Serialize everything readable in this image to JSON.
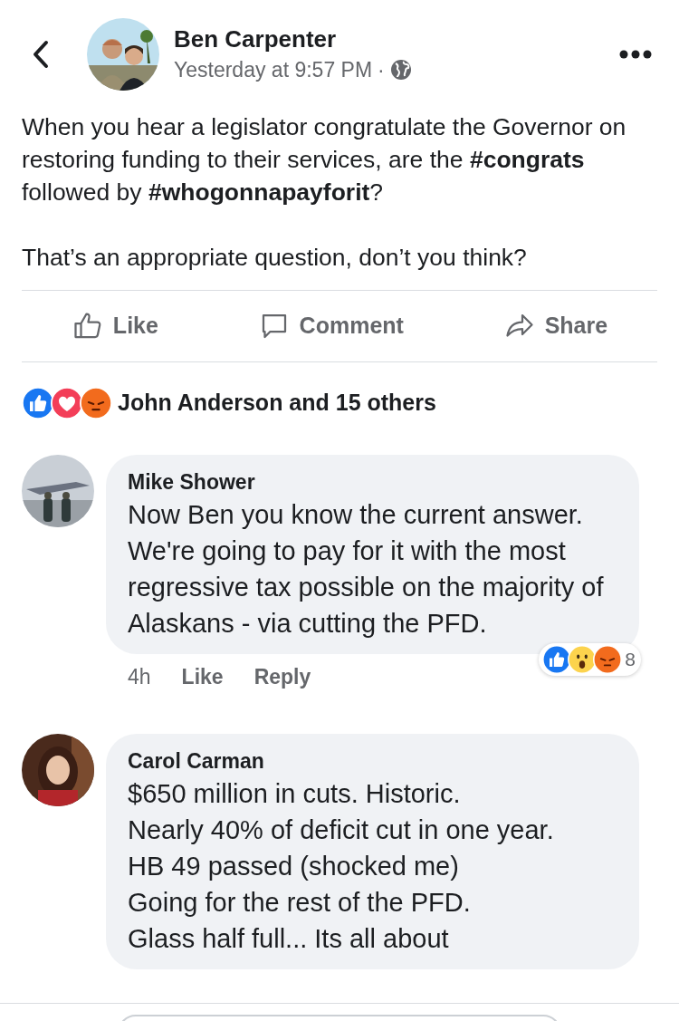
{
  "post": {
    "author": "Ben Carpenter",
    "time": "Yesterday at 9:57 PM",
    "separator": "·",
    "paragraphs": [
      "When you hear a legislator congratulate the Governor on restoring funding to their services, are the **#congrats** followed by **#whogonnapayforit**?",
      "That’s an appropriate question, don’t you think?"
    ]
  },
  "actions": [
    {
      "kind": "like",
      "label": "Like"
    },
    {
      "kind": "comment",
      "label": "Comment"
    },
    {
      "kind": "share",
      "label": "Share"
    }
  ],
  "reactions": {
    "kinds": [
      {
        "kind": "like"
      },
      {
        "kind": "love"
      },
      {
        "kind": "angry"
      }
    ],
    "summary": "John Anderson and 15 others"
  },
  "comments": [
    {
      "name": "Mike Shower",
      "lines": [
        "Now Ben you know the current answer.  We're going to pay for it with the most regressive tax possible on the majority of Alaskans - via cutting the PFD."
      ],
      "time": "4h",
      "like": "Like",
      "reply": "Reply",
      "reactions": [
        {
          "kind": "like"
        },
        {
          "kind": "wow"
        },
        {
          "kind": "angry"
        }
      ],
      "count": "8"
    },
    {
      "name": "Carol Carman",
      "lines": [
        "$650 million in cuts. Historic.",
        "Nearly 40% of deficit cut in one year.",
        "HB 49 passed (shocked me)",
        "Going for the rest of the PFD.",
        "Glass half full... Its all about"
      ]
    }
  ]
}
